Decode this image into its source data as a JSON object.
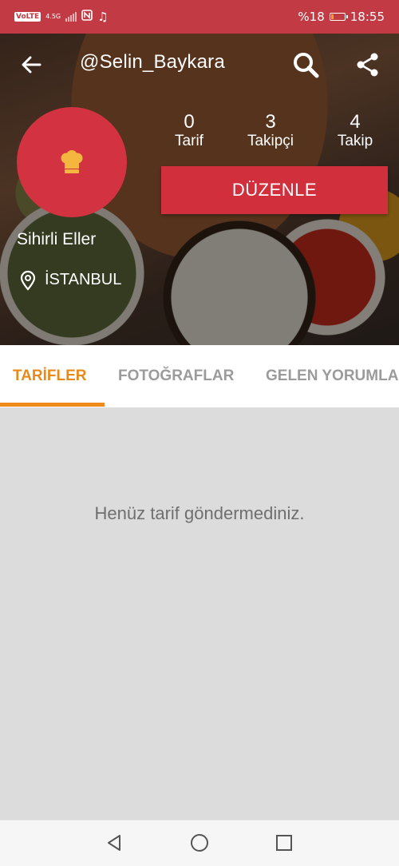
{
  "status_bar": {
    "network_badge": "VoLTE",
    "network_type": "4.5G",
    "battery_percent": "%18",
    "battery_level": 0.18,
    "time": "18:55",
    "accent_color": "#c23a44"
  },
  "appbar": {
    "title": "@Selin_Baykara",
    "back_icon": "arrow-left",
    "search_icon": "magnifier",
    "share_icon": "share-nodes"
  },
  "profile": {
    "avatar_icon": "chef-hat",
    "avatar_color": "#d33341",
    "name": "Sihirli Eller",
    "location": "İSTANBUL",
    "stats": [
      {
        "value": "0",
        "label": "Tarif"
      },
      {
        "value": "3",
        "label": "Takipçi"
      },
      {
        "value": "4",
        "label": "Takip"
      }
    ],
    "edit_label": "DÜZENLE"
  },
  "tabs": [
    {
      "label": "TARİFLER",
      "active": true
    },
    {
      "label": "FOTOĞRAFLAR",
      "active": false
    },
    {
      "label": "GELEN YORUMLA",
      "active": false
    }
  ],
  "content": {
    "empty_message": "Henüz tarif göndermediniz."
  },
  "navbar": {
    "back_icon": "triangle-back",
    "home_icon": "circle-home",
    "recent_icon": "square-recents"
  }
}
